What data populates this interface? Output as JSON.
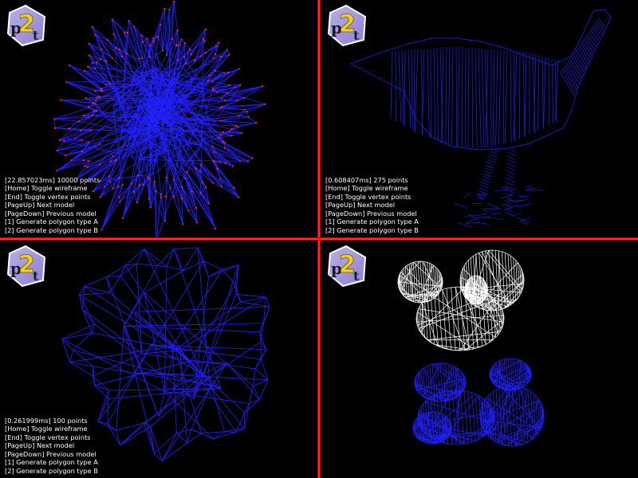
{
  "app": {
    "logo_text": "p2t"
  },
  "colors": {
    "divider": "#ff2a2a",
    "wire_blue": "#2222ff",
    "wire_white": "#ffffff",
    "vertex_red": "#ff2244",
    "text": "#ffffff",
    "logo_bg": "#8e7fd0",
    "logo_two": "#f0d020"
  },
  "panes": [
    {
      "stats": "[22.857023ms] 10000 points",
      "help": [
        "[Home] Toggle wireframe",
        "[End] Toggle vertex points",
        "[PageUp] Next model",
        "[PageDown] Previous model",
        "[1] Generate polygon type A",
        "[2] Generate polygon type B"
      ]
    },
    {
      "stats": "[0.608407ms] 275 points",
      "help": [
        "[Home] Toggle wireframe",
        "[End] Toggle vertex points",
        "[PageUp] Next model",
        "[PageDown] Previous model",
        "[1] Generate polygon type A",
        "[2] Generate polygon type B"
      ]
    },
    {
      "stats": "[0.261999ms] 100 points",
      "help": [
        "[Home] Toggle wireframe",
        "[End] Toggle vertex points",
        "[PageUp] Next model",
        "[PageDown] Previous model",
        "[1] Generate polygon type A",
        "[2] Generate polygon type B"
      ]
    },
    {
      "stats": "",
      "help": []
    }
  ]
}
